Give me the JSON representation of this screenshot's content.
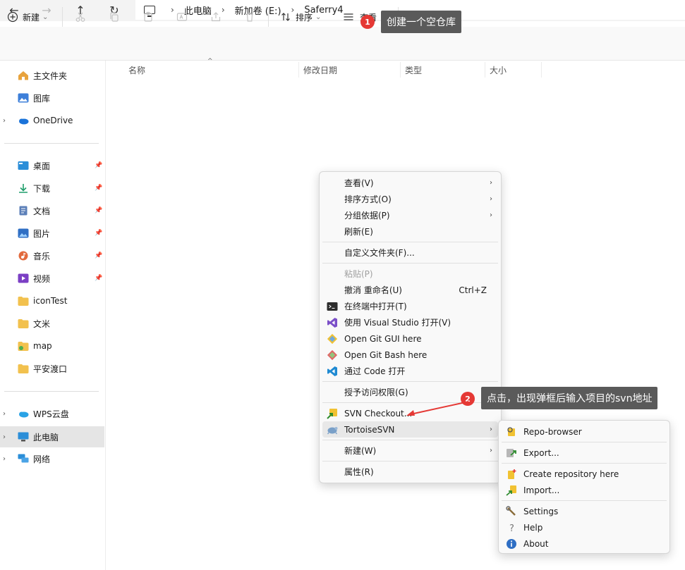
{
  "address": {
    "crumbs": [
      "此电脑",
      "新加卷 (E:)",
      "Saferry4"
    ],
    "nav": {
      "back": "←",
      "forward": "→",
      "up": "↑",
      "refresh": "↻",
      "separator": "›"
    }
  },
  "toolbar": {
    "new_label": "新建",
    "sort_label": "排序",
    "view_label": "查看",
    "more": "···",
    "dropdown": "⌄"
  },
  "sidebar": {
    "top": [
      {
        "label": "主文件夹"
      },
      {
        "label": "图库"
      },
      {
        "label": "OneDrive"
      }
    ],
    "quick": [
      {
        "label": "桌面"
      },
      {
        "label": "下载"
      },
      {
        "label": "文档"
      },
      {
        "label": "图片"
      },
      {
        "label": "音乐"
      },
      {
        "label": "视频"
      },
      {
        "label": "iconTest"
      },
      {
        "label": "文米"
      },
      {
        "label": "map"
      },
      {
        "label": "平安渡口"
      }
    ],
    "bottom": [
      {
        "label": "WPS云盘"
      },
      {
        "label": "此电脑"
      },
      {
        "label": "网络"
      }
    ],
    "pin_glyph": "📌",
    "chevron": "›"
  },
  "columns": [
    "名称",
    "修改日期",
    "类型",
    "大小"
  ],
  "context_menu": {
    "items": [
      "查看(V)",
      "排序方式(O)",
      "分组依据(P)",
      "刷新(E)",
      "自定义文件夹(F)...",
      "粘贴(P)",
      "撤消 重命名(U)",
      "在终端中打开(T)",
      "使用 Visual Studio 打开(V)",
      "Open Git GUI here",
      "Open Git Bash here",
      "通过 Code 打开",
      "授予访问权限(G)",
      "SVN Checkout...",
      "TortoiseSVN",
      "新建(W)",
      "属性(R)"
    ],
    "undo_shortcut": "Ctrl+Z",
    "arrow": "›"
  },
  "submenu": {
    "items": [
      "Repo-browser",
      "Export...",
      "Create repository here",
      "Import...",
      "Settings",
      "Help",
      "About"
    ]
  },
  "annotations": {
    "step1_number": "1",
    "step1_text": "创建一个空仓库",
    "step2_number": "2",
    "step2_text": "点击，出现弹框后输入项目的svn地址",
    "colors": {
      "badge": "#e53935",
      "tooltip": "#5a5a5a"
    }
  }
}
